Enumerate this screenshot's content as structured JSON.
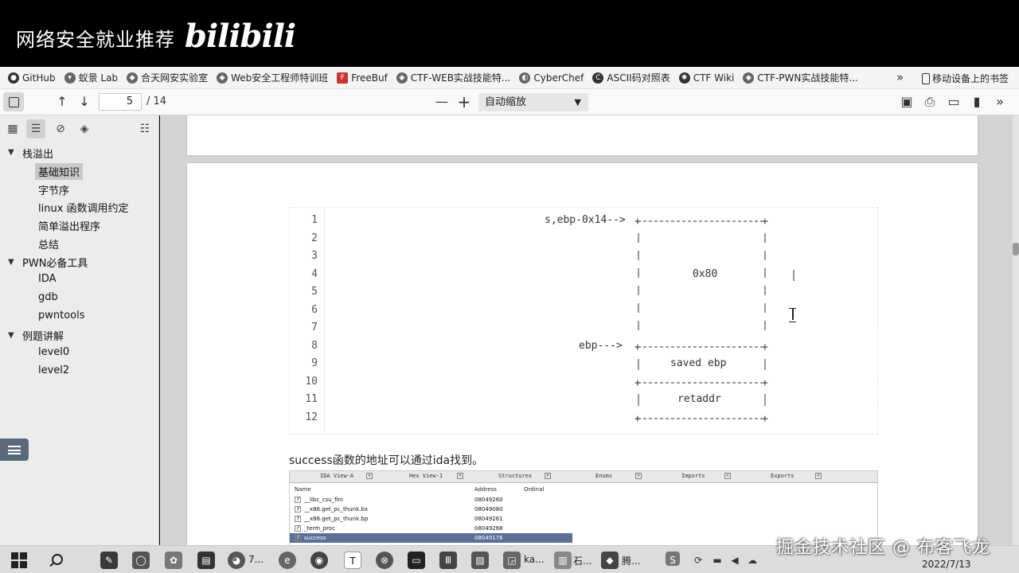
{
  "banner": {
    "title": "网络安全就业推荐",
    "logo": "bilibili"
  },
  "bookmarks": {
    "items": [
      {
        "label": "GitHub",
        "icon": "github-icon"
      },
      {
        "label": "蚁景 Lab",
        "icon": "ant-icon"
      },
      {
        "label": "合天网安实验室",
        "icon": "shield-icon"
      },
      {
        "label": "Web安全工程师特训班",
        "icon": "diamond-icon"
      },
      {
        "label": "FreeBuf",
        "icon": "freebuf-icon"
      },
      {
        "label": "CTF-WEB实战技能特...",
        "icon": "diamond-icon"
      },
      {
        "label": "CyberChef",
        "icon": "chef-icon"
      },
      {
        "label": "ASCII码对照表",
        "icon": "c-icon"
      },
      {
        "label": "CTF Wiki",
        "icon": "wiki-icon"
      },
      {
        "label": "CTF-PWN实战技能特...",
        "icon": "diamond-icon"
      }
    ],
    "more": "»",
    "mobile": "移动设备上的书签"
  },
  "toolbar": {
    "page_current": "5",
    "page_total": "/ 14",
    "zoom": "自动缩放"
  },
  "sidebar": {
    "outline": [
      {
        "label": "栈溢出",
        "level": 0
      },
      {
        "label": "基础知识",
        "level": 1,
        "selected": true
      },
      {
        "label": "字节序",
        "level": 1
      },
      {
        "label": "linux 函数调用约定",
        "level": 1
      },
      {
        "label": "简单溢出程序",
        "level": 1
      },
      {
        "label": "总结",
        "level": 1
      },
      {
        "label": "PWN必备工具",
        "level": 0
      },
      {
        "label": "IDA",
        "level": 1
      },
      {
        "label": "gdb",
        "level": 1
      },
      {
        "label": "pwntools",
        "level": 1
      },
      {
        "label": "例题讲解",
        "level": 0
      },
      {
        "label": "level0",
        "level": 1
      },
      {
        "label": "level2",
        "level": 1
      }
    ]
  },
  "code": {
    "line_numbers": [
      "1",
      "2",
      "3",
      "4",
      "5",
      "6",
      "7",
      "8",
      "9",
      "10",
      "11",
      "12"
    ],
    "label_s": "s,ebp-0x14-->",
    "label_ebp": "ebp--->",
    "box_size": "0x80",
    "saved_ebp": "saved ebp",
    "retaddr": "retaddr"
  },
  "paragraph": "success函数的地址可以通过ida找到。",
  "ida": {
    "tabs": [
      "IDA View-A",
      "Hex View-1",
      "Structures",
      "Enums",
      "Imports",
      "Exports"
    ],
    "headers": {
      "name": "Name",
      "address": "Address",
      "ordinal": "Ordinal"
    },
    "rows": [
      {
        "name": "__libc_csu_fini",
        "address": "08049260"
      },
      {
        "name": "__x86.get_pc_thunk.bx",
        "address": "08049080"
      },
      {
        "name": "__x86.get_pc_thunk.bp",
        "address": "08049261"
      },
      {
        "name": "_term_proc",
        "address": "08049268"
      },
      {
        "name": "success",
        "address": "08049176",
        "selected": true
      }
    ]
  },
  "taskbar": {
    "apps": [
      {
        "label": "7...",
        "icon": "firefox-icon"
      },
      {
        "label": "ka...",
        "icon": "app-icon"
      },
      {
        "label": "石...",
        "icon": "app-icon"
      },
      {
        "label": "腾...",
        "icon": "app-icon"
      }
    ],
    "date": "2022/7/13"
  },
  "watermark": "掘金技术社区 @ 布客飞龙"
}
